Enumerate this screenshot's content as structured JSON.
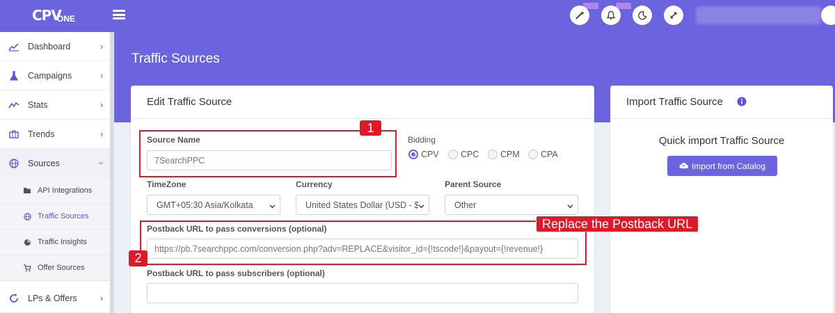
{
  "brand": {
    "logo_main": "CPV",
    "logo_sub": "ONE"
  },
  "topbar": {
    "icons": [
      "magic-wand-icon",
      "bell-icon",
      "moon-icon",
      "expand-icon"
    ]
  },
  "sidebar": {
    "items": [
      {
        "label": "Dashboard",
        "icon": "chart-line-icon"
      },
      {
        "label": "Campaigns",
        "icon": "flask-icon"
      },
      {
        "label": "Stats",
        "icon": "stats-icon"
      },
      {
        "label": "Trends",
        "icon": "briefcase-icon"
      },
      {
        "label": "Sources",
        "icon": "globe-icon"
      },
      {
        "label": "LPs & Offers",
        "icon": "refresh-icon"
      }
    ],
    "sub_items": [
      {
        "label": "API Integrations",
        "icon": "folder-icon"
      },
      {
        "label": "Traffic Sources",
        "icon": "globe-icon"
      },
      {
        "label": "Traffic Insights",
        "icon": "pie-icon"
      },
      {
        "label": "Offer Sources",
        "icon": "cart-icon"
      }
    ]
  },
  "page": {
    "title": "Traffic Sources"
  },
  "edit_card": {
    "title": "Edit Traffic Source",
    "source_name_label": "Source Name",
    "source_name_value": "7SearchPPC",
    "bidding_label": "Bidding",
    "bidding_options": [
      "CPV",
      "CPC",
      "CPM",
      "CPA"
    ],
    "bidding_selected": "CPV",
    "timezone_label": "TimeZone",
    "timezone_value": "GMT+05:30 Asia/Kolkata",
    "currency_label": "Currency",
    "currency_value": "United States Dollar (USD - $)",
    "parent_label": "Parent Source",
    "parent_value": "Other",
    "postback_label": "Postback URL to pass conversions (optional)",
    "postback_value": "https://pb.7searchppc.com/conversion.php?adv=REPLACE&visitor_id={!tscode!}&payout={!revenue!}",
    "postback_subs_label": "Postback URL to pass subscribers (optional)",
    "postback_subs_value": ""
  },
  "import_card": {
    "title": "Import Traffic Source",
    "heading": "Quick import Traffic Source",
    "button_label": "Import from Catalog"
  },
  "annotations": {
    "tag1": "1",
    "tag2": "2",
    "note": "Replace the Postback URL",
    "color": "#e0192a"
  },
  "colors": {
    "accent": "#6c63de",
    "annotation": "#e0192a"
  }
}
